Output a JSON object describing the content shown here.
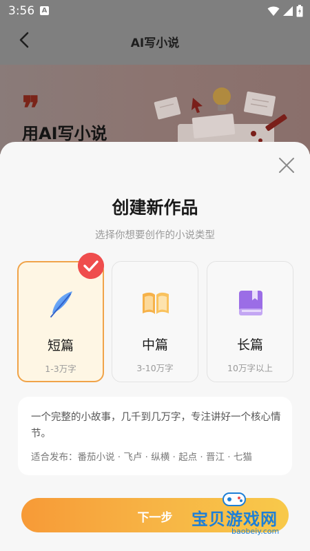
{
  "status_bar": {
    "time": "3:56",
    "notification_letter": "A"
  },
  "header": {
    "title": "AI写小说"
  },
  "banner": {
    "quote": "❞",
    "title": "用AI写小说"
  },
  "sheet": {
    "title": "创建新作品",
    "subtitle": "选择你想要创作的小说类型",
    "cards": [
      {
        "name": "短篇",
        "desc": "1-3万字",
        "icon": "feather-icon",
        "selected": true
      },
      {
        "name": "中篇",
        "desc": "3-10万字",
        "icon": "open-book-icon",
        "selected": false
      },
      {
        "name": "长篇",
        "desc": "10万字以上",
        "icon": "closed-book-icon",
        "selected": false
      }
    ],
    "info": {
      "description": "一个完整的小故事，几千到几万字，专注讲好一个核心情节。",
      "platforms": "适合发布：番茄小说 · 飞卢 · 纵横 · 起点 · 晋江 · 七猫"
    },
    "next_button": "下一步"
  },
  "watermark": {
    "text": "宝贝游戏网",
    "url": "baobeiy.com"
  },
  "colors": {
    "accent": "#f0a348",
    "badge_red": "#ef4d4d",
    "button_start": "#f79a37",
    "button_end": "#f8c94a"
  }
}
